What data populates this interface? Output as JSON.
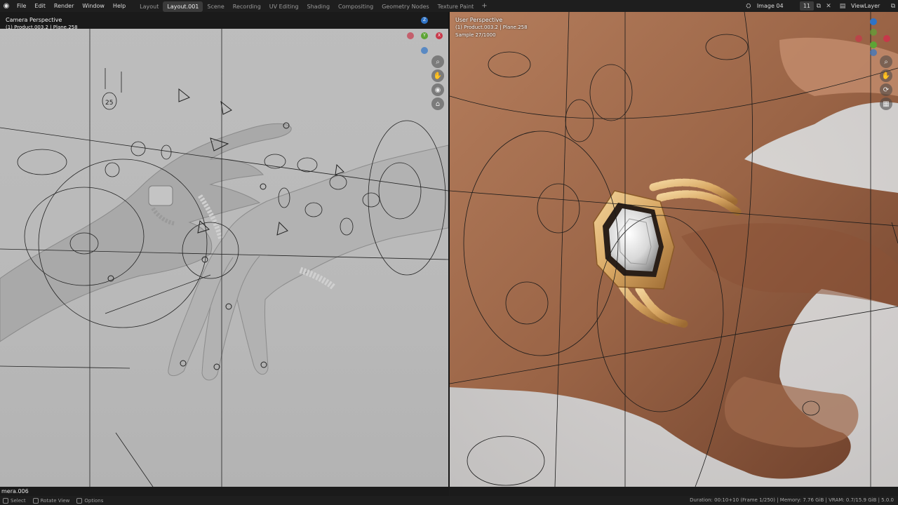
{
  "topbar": {
    "menus": [
      "File",
      "Edit",
      "Render",
      "Window",
      "Help"
    ],
    "tabs": [
      {
        "label": "Layout",
        "active": false
      },
      {
        "label": "Layout.001",
        "active": true
      },
      {
        "label": "Scene",
        "active": false
      },
      {
        "label": "Recording",
        "active": false
      },
      {
        "label": "UV Editing",
        "active": false
      },
      {
        "label": "Shading",
        "active": false
      },
      {
        "label": "Compositing",
        "active": false
      },
      {
        "label": "Geometry Nodes",
        "active": false
      },
      {
        "label": "Texture Paint",
        "active": false
      }
    ],
    "add_tab": "+",
    "scene_name": "Image 04",
    "scene_users": "11",
    "view_layer": "ViewLayer"
  },
  "left_viewport": {
    "title": "Camera Perspective",
    "subtitle": "(1) Product.003.2 | Plane.258"
  },
  "right_viewport": {
    "title": "User Perspective",
    "subtitle": "(1) Product.003.2 | Plane.258",
    "samples": "Sample 27/1000"
  },
  "camera_name": "mera.006",
  "statusbar": {
    "select": "Select",
    "rotate": "Rotate View",
    "options": "Options",
    "info": "Duration: 00:10+10 (Frame 1/250) | Memory: 7.76 GiB | VRAM: 0.7/15.9 GiB | 5.0.0"
  },
  "colors": {
    "axis_x": "#c8384a",
    "axis_y": "#5da435",
    "axis_z": "#2f73c6",
    "gold": "#d9a864",
    "skin": "#a5704e"
  },
  "gizmo_labels": {
    "x": "X",
    "y": "Y",
    "z": "Z"
  }
}
